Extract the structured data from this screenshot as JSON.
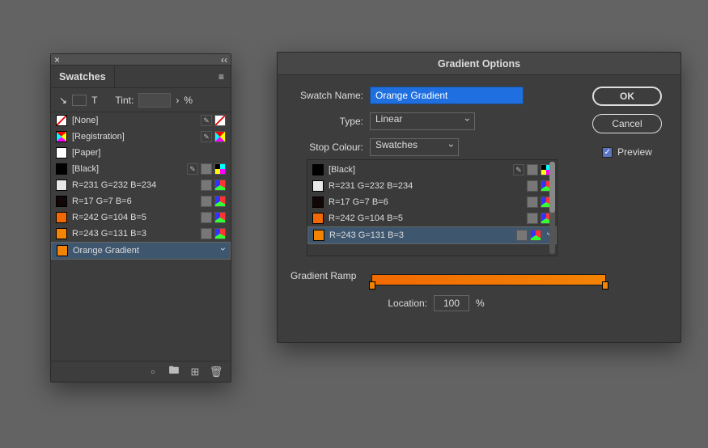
{
  "swatches_panel": {
    "title": "Swatches",
    "tint_label": "Tint:",
    "tint_value": "",
    "tint_unit": "%",
    "items": [
      {
        "label": "[None]",
        "swatch_css": "sw-none",
        "tags": [
          "pencil",
          "none"
        ]
      },
      {
        "label": "[Registration]",
        "swatch_css": "sw-reg",
        "tags": [
          "pencil",
          "reg"
        ]
      },
      {
        "label": "[Paper]",
        "color": "#ffffff",
        "tags": []
      },
      {
        "label": "[Black]",
        "color": "#000000",
        "tags": [
          "pencil",
          "grey",
          "cmyk"
        ]
      },
      {
        "label": "R=231 G=232 B=234",
        "color": "#e7e8ea",
        "tags": [
          "grey",
          "rgb"
        ]
      },
      {
        "label": "R=17 G=7 B=6",
        "color": "#110706",
        "tags": [
          "grey",
          "rgb"
        ]
      },
      {
        "label": "R=242 G=104 B=5",
        "color": "#f26805",
        "tags": [
          "grey",
          "rgb"
        ]
      },
      {
        "label": "R=243 G=131 B=3",
        "color": "#f38303",
        "tags": [
          "grey",
          "rgb"
        ]
      },
      {
        "label": "Orange Gradient",
        "color": "#f38303",
        "tags": [],
        "selected": true
      }
    ]
  },
  "dialog": {
    "title": "Gradient Options",
    "name_label": "Swatch Name:",
    "name_value": "Orange Gradient",
    "type_label": "Type:",
    "type_value": "Linear",
    "stop_label": "Stop Colour:",
    "stop_value": "Swatches",
    "stops": [
      {
        "label": "[Black]",
        "color": "#000000",
        "tags": [
          "pencil",
          "grey",
          "cmyk"
        ]
      },
      {
        "label": "R=231 G=232 B=234",
        "color": "#e7e8ea",
        "tags": [
          "grey",
          "rgb"
        ]
      },
      {
        "label": "R=17 G=7 B=6",
        "color": "#110706",
        "tags": [
          "grey",
          "rgb"
        ]
      },
      {
        "label": "R=242 G=104 B=5",
        "color": "#f26805",
        "tags": [
          "grey",
          "rgb"
        ]
      },
      {
        "label": "R=243 G=131 B=3",
        "color": "#f38303",
        "tags": [
          "grey",
          "rgb"
        ],
        "selected": true
      }
    ],
    "ramp_label": "Gradient Ramp",
    "location_label": "Location:",
    "location_value": "100",
    "location_unit": "%",
    "ok": "OK",
    "cancel": "Cancel",
    "preview_label": "Preview",
    "preview_checked": true
  }
}
